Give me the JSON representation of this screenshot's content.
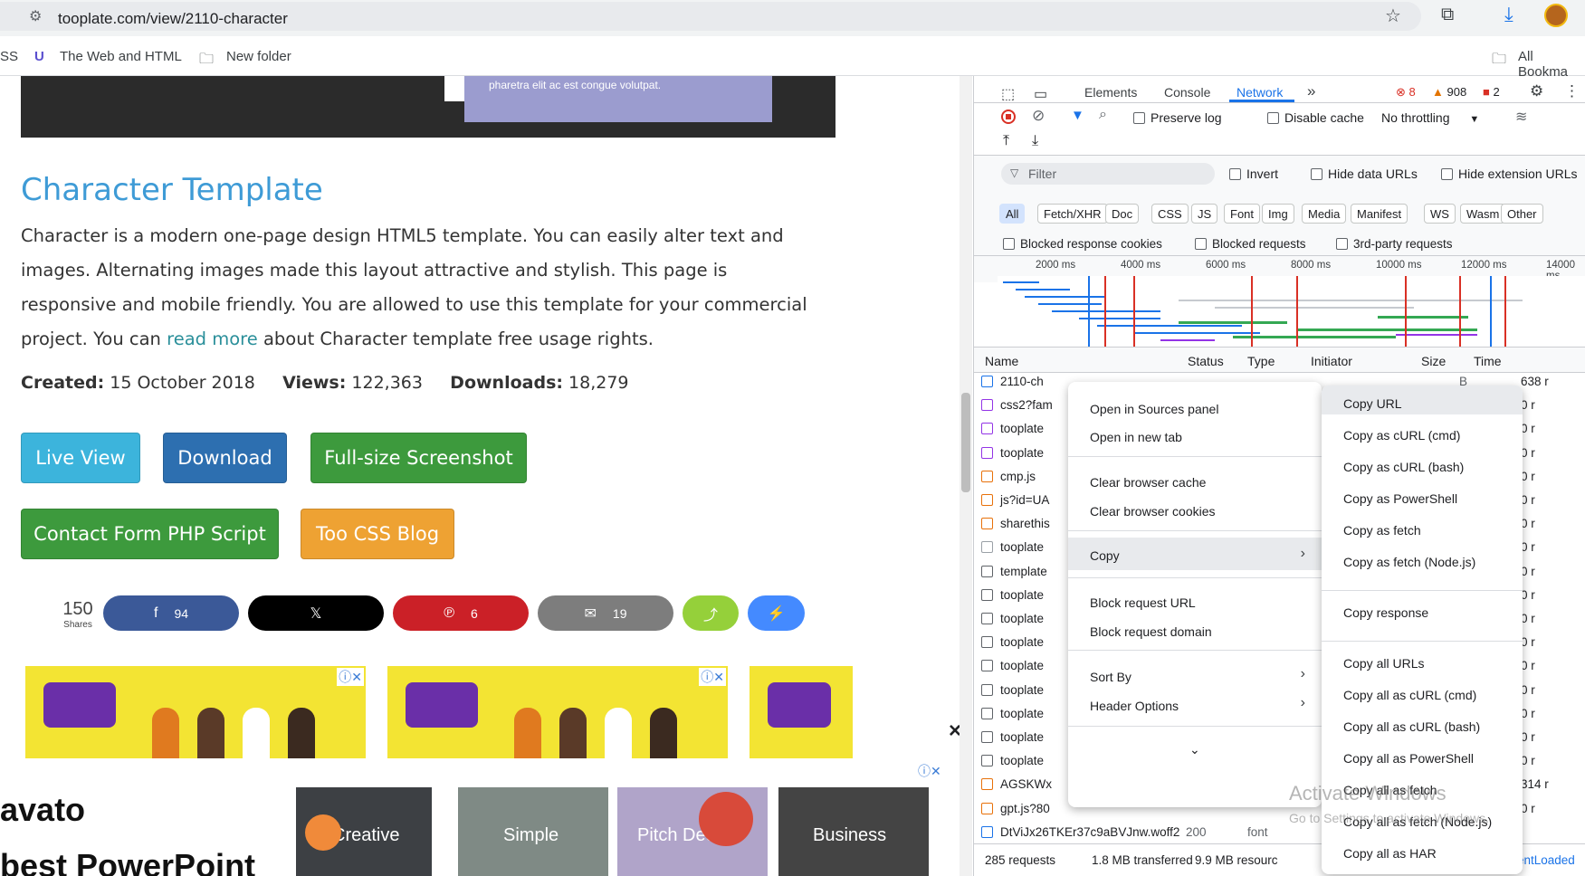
{
  "browser": {
    "url": "tooplate.com/view/2110-character",
    "bookmarks": [
      "The Web and HTML",
      "New folder"
    ],
    "bookmarks_left_fragment": "SS",
    "bookmarks_right": "All Bookma"
  },
  "page": {
    "hero_text": "pharetra elit ac est congue volutpat.",
    "title": "Character Template",
    "desc_part1": "Character is a modern one-page design HTML5 template. You can easily alter text and images. Alternating images made this layout attractive and stylish. This page is responsive and mobile friendly. You are allowed to use this template for your commercial project. You can ",
    "desc_link": "read more",
    "desc_part2": " about Character template free usage rights.",
    "created_label": "Created:",
    "created_value": "15 October 2018",
    "views_label": "Views:",
    "views_value": "122,363",
    "downloads_label": "Downloads:",
    "downloads_value": "18,279",
    "buttons": {
      "live_view": "Live View",
      "download": "Download",
      "screenshot": "Full-size Screenshot",
      "contact": "Contact Form PHP Script",
      "blog": "Too CSS Blog"
    },
    "shares_count": "150",
    "shares_label": "Shares",
    "share_buttons": [
      {
        "icon": "f",
        "count": "94",
        "color": "#3b5998"
      },
      {
        "icon": "𝕏",
        "count": "",
        "color": "#000000"
      },
      {
        "icon": "℗",
        "count": "6",
        "color": "#cb2027"
      },
      {
        "icon": "✉",
        "count": "19",
        "color": "#7d7d7d"
      },
      {
        "icon": "⤴",
        "count": "",
        "color": "#95d03a"
      },
      {
        "icon": "⚡",
        "count": "",
        "color": "#448aff"
      }
    ],
    "close_x": "×",
    "bottom_ad": {
      "brand": "avato",
      "tagline": "best PowerPoint",
      "tiles": [
        "Creative",
        "Simple",
        "Pitch Decks",
        "Business"
      ]
    }
  },
  "devtools": {
    "tabs": [
      "Elements",
      "Console",
      "Network"
    ],
    "active_tab": "Network",
    "more_tabs": "»",
    "errors": "8",
    "warnings": "908",
    "issues": "2",
    "preserve_log": "Preserve log",
    "disable_cache": "Disable cache",
    "throttling": "No throttling",
    "filter_placeholder": "Filter",
    "invert": "Invert",
    "hide_data_urls": "Hide data URLs",
    "hide_ext_urls": "Hide extension URLs",
    "type_chips": [
      "All",
      "Fetch/XHR",
      "Doc",
      "CSS",
      "JS",
      "Font",
      "Img",
      "Media",
      "Manifest",
      "WS",
      "Wasm",
      "Other"
    ],
    "blocked_resp_cookies": "Blocked response cookies",
    "blocked_requests": "Blocked requests",
    "third_party": "3rd-party requests",
    "timeline_ticks": [
      "2000 ms",
      "4000 ms",
      "6000 ms",
      "8000 ms",
      "10000 ms",
      "12000 ms",
      "14000 ms"
    ],
    "columns": [
      "Name",
      "Status",
      "Type",
      "Initiator",
      "Size",
      "Time"
    ],
    "requests": [
      {
        "name": "2110-ch",
        "size": "B",
        "time": "638 r"
      },
      {
        "name": "css2?fam",
        "size": "..",
        "time": "0 r"
      },
      {
        "name": "tooplate",
        "size": "..",
        "time": "0 r"
      },
      {
        "name": "tooplate",
        "size": "..",
        "time": "0 r"
      },
      {
        "name": "cmp.js",
        "size": "..",
        "time": "0 r"
      },
      {
        "name": "js?id=UA",
        "size": "..",
        "time": "0 r"
      },
      {
        "name": "sharethis",
        "size": "..",
        "time": "0 r"
      },
      {
        "name": "tooplate",
        "size": "..",
        "time": "0 r"
      },
      {
        "name": "template",
        "size": "..",
        "time": "0 r"
      },
      {
        "name": "tooplate",
        "size": "..",
        "time": "0 r"
      },
      {
        "name": "tooplate",
        "size": "..",
        "time": "0 r"
      },
      {
        "name": "tooplate",
        "size": "..",
        "time": "0 r"
      },
      {
        "name": "tooplate",
        "size": "..",
        "time": "0 r"
      },
      {
        "name": "tooplate",
        "size": "..",
        "time": "0 r"
      },
      {
        "name": "tooplate",
        "size": "..",
        "time": "0 r"
      },
      {
        "name": "tooplate",
        "size": "..",
        "time": "0 r"
      },
      {
        "name": "tooplate",
        "size": "..",
        "time": "0 r"
      },
      {
        "name": "AGSKWx",
        "size": "B",
        "time": "314 r"
      },
      {
        "name": "gpt.js?80",
        "size": "..",
        "time": "0 r"
      },
      {
        "name": "DtViJx26TKEr37c9aBVJnw.woff2",
        "status": "200",
        "type": "font",
        "size": "",
        "time": ""
      }
    ],
    "status_requests": "285 requests",
    "status_transferred": "1.8 MB transferred",
    "status_resources": "9.9 MB resourc",
    "status_dom": "entLoaded"
  },
  "context_menu": {
    "items": [
      "Open in Sources panel",
      "Open in new tab",
      "Clear browser cache",
      "Clear browser cookies",
      "Copy",
      "Block request URL",
      "Block request domain",
      "Sort By",
      "Header Options"
    ],
    "more_arrow": "⌄"
  },
  "copy_submenu": {
    "items": [
      "Copy URL",
      "Copy as cURL (cmd)",
      "Copy as cURL (bash)",
      "Copy as PowerShell",
      "Copy as fetch",
      "Copy as fetch (Node.js)",
      "Copy response",
      "Copy all URLs",
      "Copy all as cURL (cmd)",
      "Copy all as cURL (bash)",
      "Copy all as PowerShell",
      "Copy all as fetch",
      "Copy all as fetch (Node.js)",
      "Copy all as HAR"
    ]
  },
  "watermark": {
    "line1": "Activate Windows",
    "line2": "Go to Settings to activate Windows."
  }
}
